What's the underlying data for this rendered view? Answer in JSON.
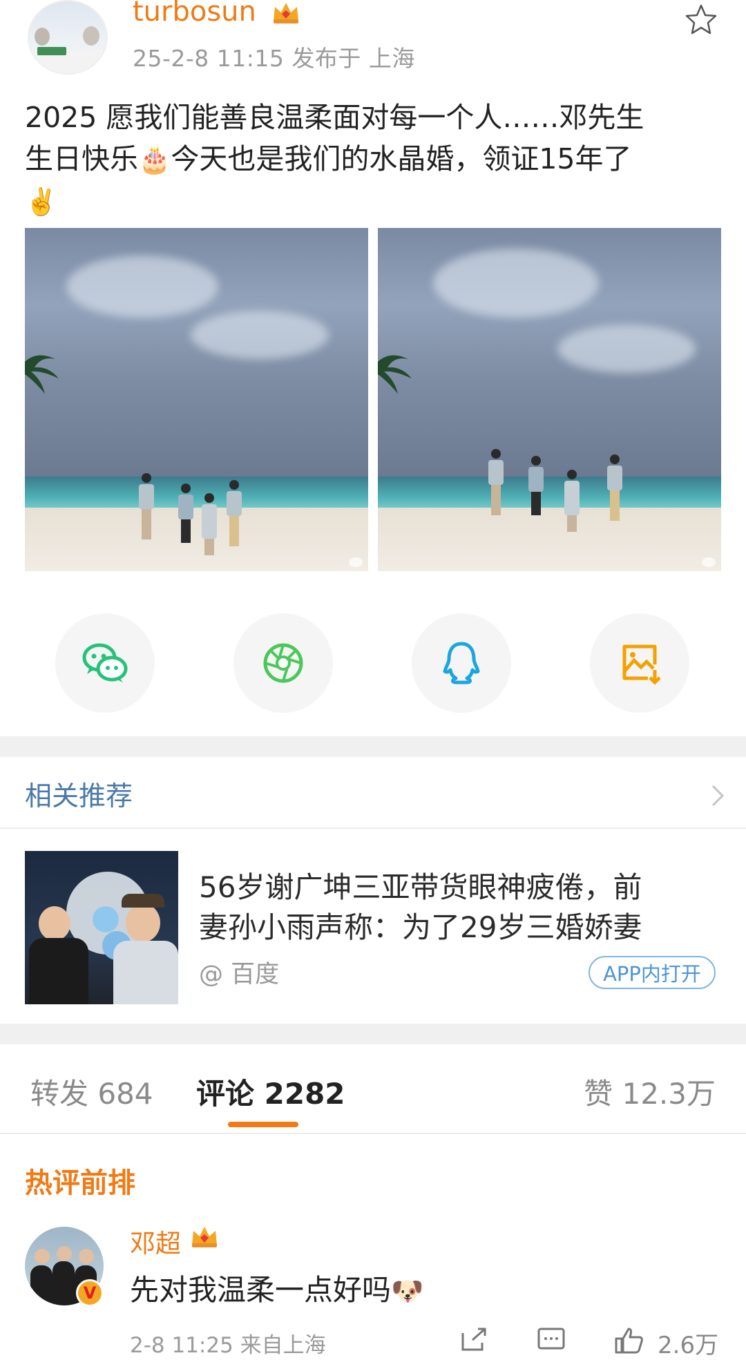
{
  "post": {
    "username": "turbosun",
    "meta": "25-2-8 11:15   发布于 上海",
    "text_line1": "2025 愿我们能善良温柔面对每一个人……邓先生",
    "text_line2_a": "生日快乐",
    "text_line2_b": "今天也是我们的水晶婚，领证15年了",
    "emoji_cake": "🎂",
    "emoji_victory": "✌️"
  },
  "share": {
    "icons": [
      "wechat-icon",
      "moments-icon",
      "qq-icon",
      "save-image-icon"
    ],
    "colors": {
      "wechat": "#25c27a",
      "moments": "#4cc85a",
      "qq": "#1ba6e0",
      "save": "#f5a100"
    }
  },
  "related": {
    "title": "相关推荐",
    "article_title_line1": "56岁谢广坤三亚带货眼神疲倦，前",
    "article_title_line2": "妻孙小雨声称：为了29岁三婚娇妻",
    "source": "@ 百度",
    "app_button": "APP内打开"
  },
  "tabs": {
    "repost": "转发 684",
    "comments": "评论 2282",
    "likes": "赞 12.3万"
  },
  "comments": {
    "section_title": "热评前排",
    "items": [
      {
        "name": "邓超",
        "text": "先对我温柔一点好吗",
        "emoji": "🐶",
        "meta": "2-8 11:25  来自上海",
        "like_count": "2.6万"
      }
    ]
  },
  "colors": {
    "accent": "#f07a14",
    "link": "#4a79a8"
  }
}
